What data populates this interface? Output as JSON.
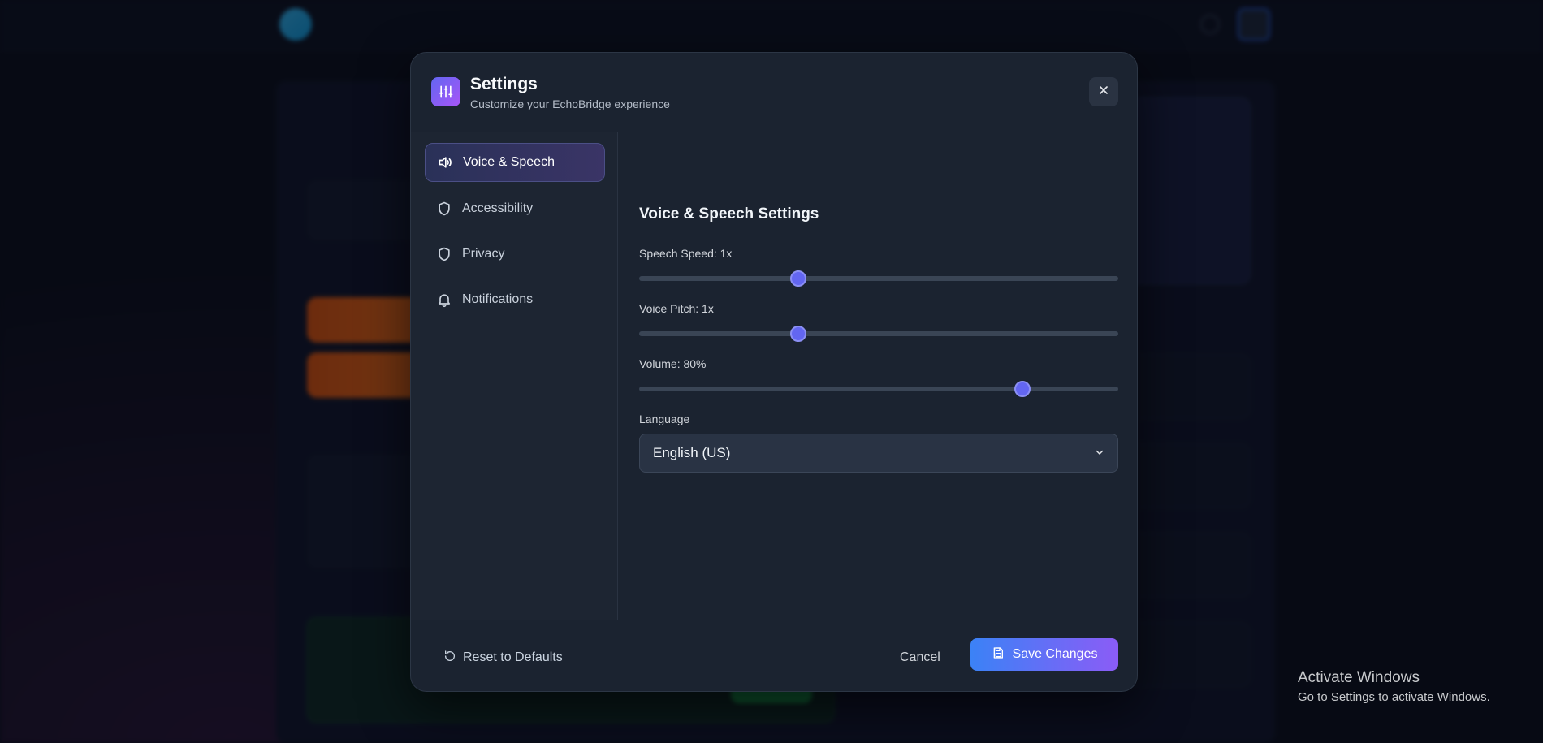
{
  "modal": {
    "title": "Settings",
    "subtitle": "Customize your EchoBridge experience",
    "close_icon": "close-icon",
    "header_icon": "sliders-icon"
  },
  "sidebar": {
    "items": [
      {
        "label": "Voice & Speech",
        "icon": "speaker-icon",
        "active": true
      },
      {
        "label": "Accessibility",
        "icon": "shield-icon",
        "active": false
      },
      {
        "label": "Privacy",
        "icon": "shield-icon",
        "active": false
      },
      {
        "label": "Notifications",
        "icon": "bell-icon",
        "active": false
      }
    ]
  },
  "content": {
    "section_title": "Voice & Speech Settings",
    "sliders": [
      {
        "label": "Speech Speed: 1x",
        "value_fraction": 0.333
      },
      {
        "label": "Voice Pitch: 1x",
        "value_fraction": 0.333
      },
      {
        "label": "Volume: 80%",
        "value_fraction": 0.8
      }
    ],
    "language_label": "Language",
    "language_value": "English (US)"
  },
  "footer": {
    "reset_label": "Reset to Defaults",
    "cancel_label": "Cancel",
    "save_label": "Save Changes"
  },
  "watermark": {
    "title": "Activate Windows",
    "subtitle": "Go to Settings to activate Windows."
  },
  "colors": {
    "accent": "#6366f1",
    "save_gradient_start": "#3b82f6",
    "save_gradient_end": "#8b5cf6"
  }
}
